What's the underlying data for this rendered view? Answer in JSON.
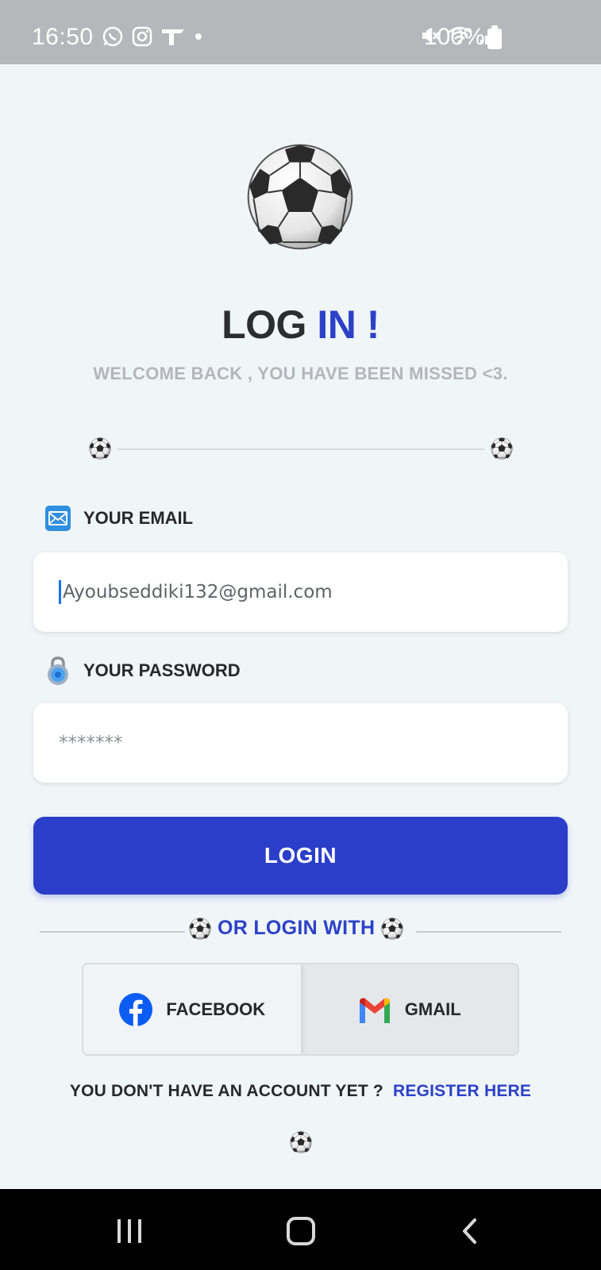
{
  "status_bar": {
    "time": "16:50",
    "battery": "100%",
    "left_icons": [
      "whatsapp-icon",
      "instagram-icon",
      "app-icon",
      "dot-icon"
    ],
    "right_icons": [
      "mute-icon",
      "wifi-icon",
      "signal-icon",
      "battery-icon"
    ]
  },
  "header": {
    "title_part1": "LOG",
    "title_part2": "IN !",
    "subtitle": "WELCOME BACK , YOU HAVE BEEN MISSED <3."
  },
  "form": {
    "email_label": "YOUR EMAIL",
    "email_value": "Ayoubseddiki132@gmail.com",
    "password_label": "YOUR PASSWORD",
    "password_placeholder": "*******",
    "login_button": "LOGIN"
  },
  "social": {
    "or_text": "OR LOGIN WITH",
    "facebook_label": "FACEBOOK",
    "gmail_label": "GMAIL"
  },
  "register": {
    "prompt": "YOU DON'T HAVE AN ACCOUNT YET ?",
    "link": "REGISTER HERE"
  },
  "colors": {
    "accent": "#2c41c8",
    "button": "#2b3ec9",
    "background": "#f0f5f8",
    "status_bar": "#b5b7ba"
  }
}
